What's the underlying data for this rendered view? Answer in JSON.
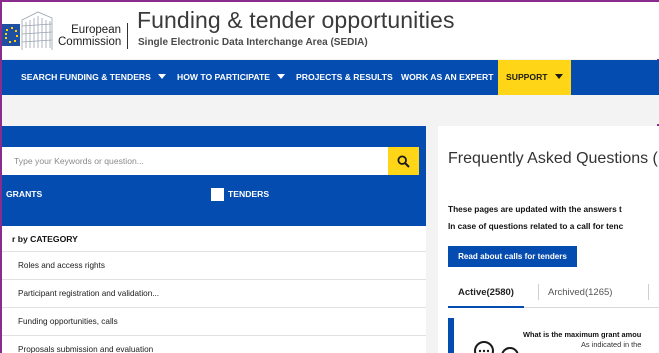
{
  "header": {
    "org_line1": "European",
    "org_line2": "Commission",
    "title": "Funding & tender opportunities",
    "subtitle": "Single Electronic Data Interchange Area (SEDIA)"
  },
  "nav": {
    "items": [
      {
        "label": "SEARCH FUNDING & TENDERS",
        "dropdown": true
      },
      {
        "label": "HOW TO PARTICIPATE",
        "dropdown": true
      },
      {
        "label": "PROJECTS & RESULTS",
        "dropdown": false
      },
      {
        "label": "WORK AS AN EXPERT",
        "dropdown": false
      },
      {
        "label": "SUPPORT",
        "dropdown": true,
        "highlighted": true
      }
    ]
  },
  "search": {
    "placeholder": "Type your Keywords or question...",
    "button_icon": "search-icon",
    "filters": [
      {
        "label": "GRANTS",
        "checked": false
      },
      {
        "label": "TENDERS",
        "checked": false
      }
    ]
  },
  "category": {
    "header": "r by CATEGORY",
    "items": [
      "Roles and access rights",
      "Participant registration and validation...",
      "Funding opportunities, calls",
      "Proposals submission and evaluation"
    ]
  },
  "faq": {
    "title": "Frequently Asked Questions (FA",
    "info_line1": "These pages are updated with the answers t",
    "info_line2": "In case of questions related to a call for tenc",
    "read_button": "Read about calls for tenders",
    "tabs": [
      {
        "label": "Active(2580)",
        "active": true
      },
      {
        "label": "Archived(1265)",
        "active": false
      }
    ],
    "card": {
      "question": "What is the maximum grant amou",
      "answer": "As indicated in the"
    }
  },
  "colors": {
    "primary_blue": "#054cb0",
    "accent_yellow": "#ffd617",
    "background": "#f3f3f3"
  }
}
